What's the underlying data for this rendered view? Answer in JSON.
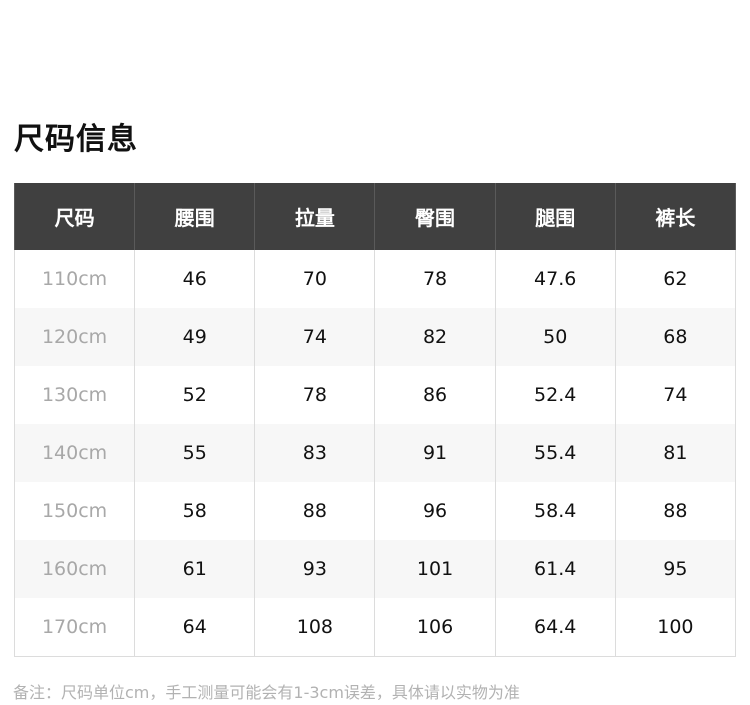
{
  "title": "尺码信息",
  "table": {
    "headers": [
      "尺码",
      "腰围",
      "拉量",
      "臀围",
      "腿围",
      "裤长"
    ],
    "rows": [
      [
        "110cm",
        "46",
        "70",
        "78",
        "47.6",
        "62"
      ],
      [
        "120cm",
        "49",
        "74",
        "82",
        "50",
        "68"
      ],
      [
        "130cm",
        "52",
        "78",
        "86",
        "52.4",
        "74"
      ],
      [
        "140cm",
        "55",
        "83",
        "91",
        "55.4",
        "81"
      ],
      [
        "150cm",
        "58",
        "88",
        "96",
        "58.4",
        "88"
      ],
      [
        "160cm",
        "61",
        "93",
        "101",
        "61.4",
        "95"
      ],
      [
        "170cm",
        "64",
        "108",
        "106",
        "64.4",
        "100"
      ]
    ]
  },
  "note": "备注：尺码单位cm，手工测量可能会有1-3cm误差，具体请以实物为准",
  "colors": {
    "header_bg": "#404040",
    "header_text": "#ffffff",
    "size_text": "#a8a8a8",
    "value_text": "#111111",
    "note_text": "#b2b2b2"
  }
}
